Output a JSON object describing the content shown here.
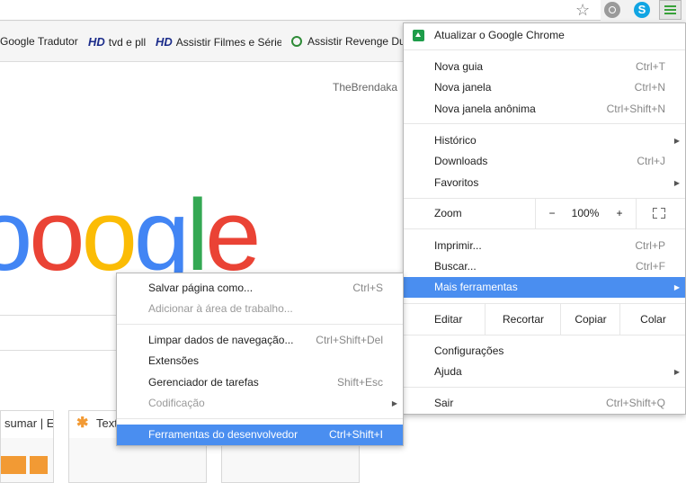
{
  "bookmarks": [
    {
      "label": "Google Tradutor",
      "icon": "none"
    },
    {
      "label": "tvd e pll",
      "icon": "HD"
    },
    {
      "label": "Assistir Filmes e Série",
      "icon": "HD"
    },
    {
      "label": "Assistir Revenge Du",
      "icon": "play"
    }
  ],
  "page": {
    "username": "TheBrendaka",
    "tiles": [
      {
        "title": "sumar | Ec"
      },
      {
        "title": "Text"
      }
    ]
  },
  "menu": {
    "update": "Atualizar o Google Chrome",
    "new_tab": "Nova guia",
    "new_tab_sc": "Ctrl+T",
    "new_window": "Nova janela",
    "new_window_sc": "Ctrl+N",
    "incognito": "Nova janela anônima",
    "incognito_sc": "Ctrl+Shift+N",
    "history": "Histórico",
    "downloads": "Downloads",
    "downloads_sc": "Ctrl+J",
    "favorites": "Favoritos",
    "zoom": "Zoom",
    "zoom_minus": "−",
    "zoom_value": "100%",
    "zoom_plus": "+",
    "print": "Imprimir...",
    "print_sc": "Ctrl+P",
    "find": "Buscar...",
    "find_sc": "Ctrl+F",
    "more_tools": "Mais ferramentas",
    "edit": "Editar",
    "cut": "Recortar",
    "copy": "Copiar",
    "paste": "Colar",
    "settings": "Configurações",
    "help": "Ajuda",
    "exit": "Sair",
    "exit_sc": "Ctrl+Shift+Q"
  },
  "submenu": {
    "save_page": "Salvar página como...",
    "save_page_sc": "Ctrl+S",
    "add_desktop": "Adicionar à área de trabalho...",
    "clear_data": "Limpar dados de navegação...",
    "clear_data_sc": "Ctrl+Shift+Del",
    "extensions": "Extensões",
    "task_manager": "Gerenciador de tarefas",
    "task_manager_sc": "Shift+Esc",
    "encoding": "Codificação",
    "devtools": "Ferramentas do desenvolvedor",
    "devtools_sc": "Ctrl+Shift+I"
  },
  "colors": {
    "highlight": "#4a8ef0",
    "google_blue": "#4285f4",
    "google_red": "#ea4335",
    "google_yellow": "#fbbc05",
    "google_green": "#34a853"
  }
}
